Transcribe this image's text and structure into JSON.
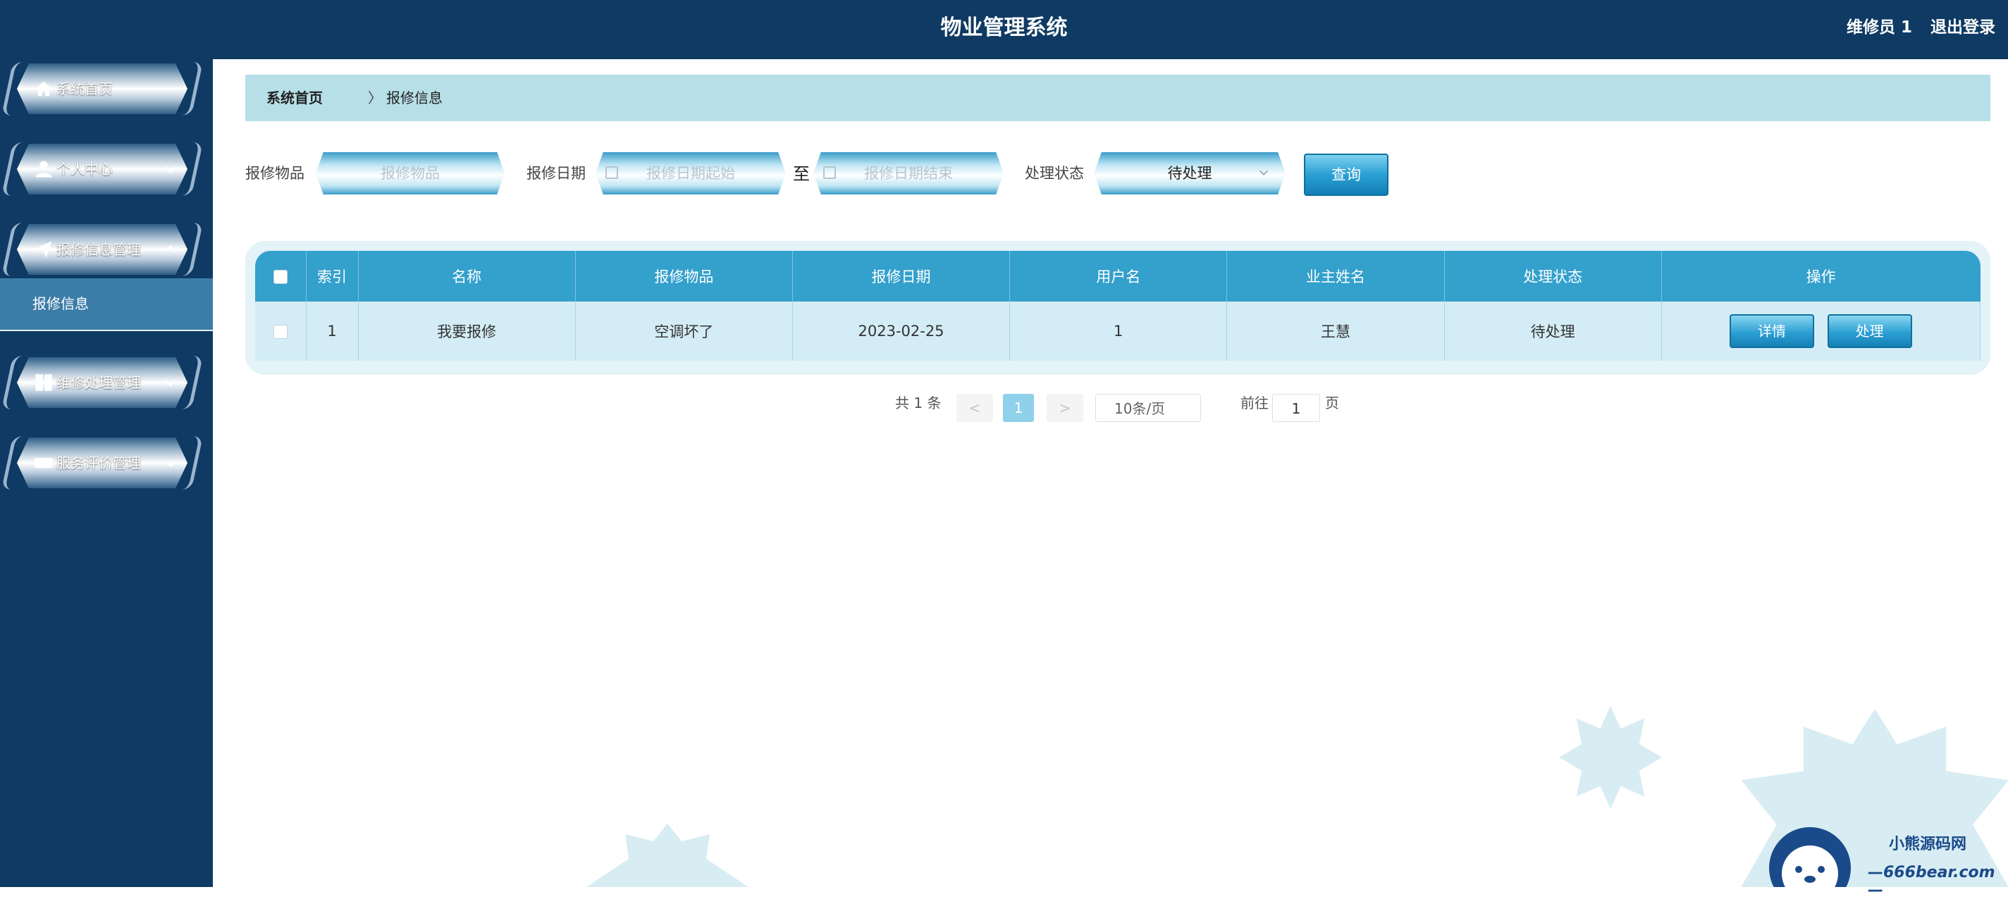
{
  "header": {
    "title": "物业管理系统",
    "user_label": "维修员 1",
    "logout_label": "退出登录"
  },
  "sidebar": {
    "items": [
      {
        "label": "系统首页",
        "icon": "home-icon"
      },
      {
        "label": "个人中心",
        "icon": "user-icon"
      },
      {
        "label": "报修信息管理",
        "icon": "paper-plane-icon"
      },
      {
        "label": "维修处理管理",
        "icon": "grid-icon"
      },
      {
        "label": "服务评价管理",
        "icon": "ticket-icon"
      }
    ],
    "submenu_active": "报修信息"
  },
  "breadcrumb": {
    "home": "系统首页",
    "separator": "〉",
    "current": "报修信息"
  },
  "search": {
    "item_label": "报修物品",
    "item_placeholder": "报修物品",
    "date_label": "报修日期",
    "date_start_placeholder": "报修日期起始",
    "date_to": "至",
    "date_end_placeholder": "报修日期结束",
    "status_label": "处理状态",
    "status_value": "待处理",
    "query_button": "查询"
  },
  "table": {
    "headers": [
      "索引",
      "名称",
      "报修物品",
      "报修日期",
      "用户名",
      "业主姓名",
      "处理状态",
      "操作"
    ],
    "rows": [
      {
        "index": "1",
        "name": "我要报修",
        "item": "空调坏了",
        "date": "2023-02-25",
        "username": "1",
        "owner": "王慧",
        "status": "待处理",
        "actions": [
          "详情",
          "处理"
        ]
      }
    ]
  },
  "pagination": {
    "total": "共 1 条",
    "prev": "<",
    "current_page": "1",
    "next": ">",
    "page_size": "10条/页",
    "goto_label": "前往",
    "goto_value": "1",
    "goto_suffix": "页"
  },
  "watermark": {
    "line1": "小熊源码网",
    "line2": "—666bear.com—"
  },
  "colors": {
    "nav_bg": "#0e3a63",
    "accent": "#34a0cc",
    "breadcrumb_bg": "#b7dfe8"
  }
}
